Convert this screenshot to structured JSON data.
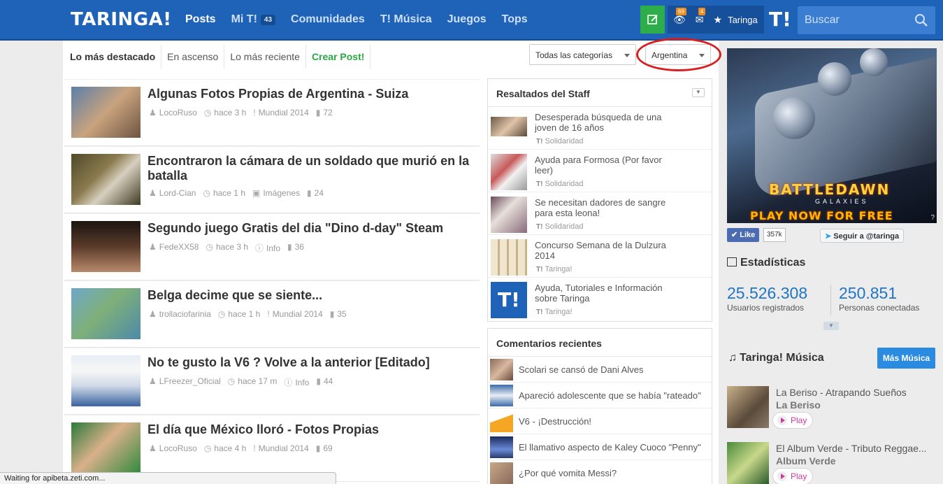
{
  "header": {
    "logo": "TARINGA!",
    "nav": [
      {
        "label": "Posts",
        "active": true
      },
      {
        "label": "Mi T!",
        "count": "43"
      },
      {
        "label": "Comunidades"
      },
      {
        "label": "T! Música"
      },
      {
        "label": "Juegos"
      },
      {
        "label": "Tops"
      }
    ],
    "monitor_badge": "69",
    "messages_badge": "4",
    "username": "Taringa",
    "t_logo": "T!",
    "search_placeholder": "Buscar"
  },
  "tabs": [
    {
      "label": "Lo más destacado"
    },
    {
      "label": "En ascenso"
    },
    {
      "label": "Lo más reciente"
    },
    {
      "label": "Crear Post!"
    }
  ],
  "filters": {
    "category": "Todas las categorías",
    "country": "Argentina"
  },
  "posts": [
    {
      "title": "Algunas Fotos Propias de Argentina - Suiza",
      "user": "LocoRuso",
      "time": "hace 3 h",
      "category": "Mundial 2014",
      "comments": "72"
    },
    {
      "title": "Encontraron la cámara de un soldado que murió en la batalla",
      "user": "Lord-Cian",
      "time": "hace 1 h",
      "category": "Imágenes",
      "comments": "24"
    },
    {
      "title": "Segundo juego Gratis del dia \"Dino d-day\" Steam",
      "user": "FedeXX58",
      "time": "hace 3 h",
      "category": "Info",
      "comments": "36"
    },
    {
      "title": "Belga decime que se siente...",
      "user": "trollaciofarinia",
      "time": "hace 1 h",
      "category": "Mundial 2014",
      "comments": "35"
    },
    {
      "title": "No te gusto la V6 ? Volve a la anterior [Editado]",
      "user": "LFreezer_Oficial",
      "time": "hace 17 m",
      "category": "Info",
      "comments": "44"
    },
    {
      "title": "El día que México lloró - Fotos Propias",
      "user": "LocoRuso",
      "time": "hace 4 h",
      "category": "Mundial 2014",
      "comments": "69"
    }
  ],
  "staff": {
    "title": "Resaltados del Staff",
    "items": [
      {
        "title": "Desesperada búsqueda de una joven de 16 años",
        "category": "Solidaridad"
      },
      {
        "title": "Ayuda para Formosa (Por favor leer)",
        "category": "Solidaridad"
      },
      {
        "title": "Se necesitan dadores de sangre para esta leona!",
        "category": "Solidaridad"
      },
      {
        "title": "Concurso Semana de la Dulzura 2014",
        "category": "Taringa!"
      },
      {
        "title": "Ayuda, Tutoriales e Información sobre Taringa",
        "category": "Taringa!"
      }
    ]
  },
  "comments": {
    "title": "Comentarios recientes",
    "items": [
      {
        "text": "Scolari se cansó de Dani Alves"
      },
      {
        "text": "Apareció adolescente que se había \"rateado\""
      },
      {
        "text": "V6 - ¡Destrucción!"
      },
      {
        "text": "El llamativo aspecto de Kaley Cuoco \"Penny\""
      },
      {
        "text": "¿Por qué vomita Messi?"
      }
    ]
  },
  "ad": {
    "brand": "BATTLEDAWN",
    "sub": "GALAXIES",
    "cta": "PLAY NOW FOR FREE",
    "info": "?"
  },
  "social": {
    "like_label": "Like",
    "like_count": "357k",
    "twitter_label": "Seguir a @taringa"
  },
  "stats": {
    "title": "Estadísticas",
    "users_value": "25.526.308",
    "users_label": "Usuarios registrados",
    "online_value": "250.851",
    "online_label": "Personas conectadas"
  },
  "music": {
    "title": "Taringa! Música",
    "more_button": "Más Música",
    "items": [
      {
        "title": "La Beriso - Atrapando Sueños",
        "artist": "La Beriso",
        "play": "Play"
      },
      {
        "title": "El Album Verde - Tributo Reggae...",
        "artist": "Album Verde",
        "play": "Play"
      }
    ]
  },
  "statusbar": "Waiting for apibeta.zeti.com...",
  "colors": {
    "header_bg": "#1e63b8",
    "accent_blue": "#1f74c6",
    "create_green": "#2dae4a",
    "highlight_red": "#d81f1f"
  }
}
